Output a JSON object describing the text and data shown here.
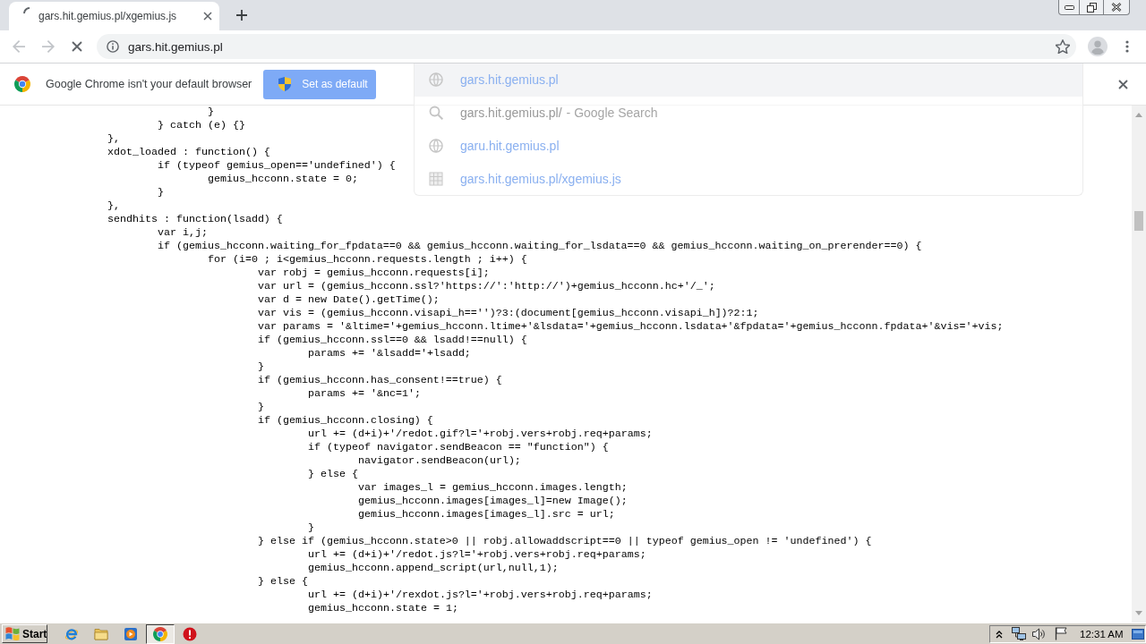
{
  "tab_strip": {
    "tabs": [
      {
        "title": "gars.hit.gemius.pl/xgemius.js",
        "selected": true,
        "loading": true
      }
    ]
  },
  "toolbar": {
    "nav": [
      {
        "kind": "back",
        "disabled": true
      },
      {
        "kind": "forward",
        "disabled": true
      },
      {
        "kind": "stop",
        "disabled": false
      }
    ],
    "omnibox": {
      "value": "gars.hit.gemius.pl"
    }
  },
  "infobar": {
    "message": "Google Chrome isn't your default browser",
    "button": "Set as default"
  },
  "suggestions": [
    {
      "kind": "url",
      "text": "gars.hit.gemius.pl",
      "selected": true
    },
    {
      "kind": "search",
      "text": "gars.hit.gemius.pl/",
      "description": "- Google Search",
      "selected": false
    },
    {
      "kind": "url",
      "text": "garu.hit.gemius.pl",
      "selected": false
    },
    {
      "kind": "page",
      "text": "gars.hit.gemius.pl/xgemius.js",
      "selected": false
    }
  ],
  "code": {
    "lines": [
      {
        "children": [
          {
            "children": [
              {
                "text": "}"
              }
            ]
          },
          {
            "text": "} catch (e) {}"
          }
        ]
      },
      {
        "text": "},"
      },
      {
        "text": "xdot_loaded : function() {",
        "children": [
          {
            "text": "if (typeof gemius_open=='undefined') {",
            "children": [
              {
                "text": "gemius_hcconn.state = 0;"
              }
            ]
          },
          {
            "text": "}"
          }
        ]
      },
      {
        "text": "},"
      },
      {
        "text": "sendhits : function(lsadd) {",
        "children": [
          {
            "text": "var i,j;"
          },
          {
            "text": "if (gemius_hcconn.waiting_for_fpdata==0 && gemius_hcconn.waiting_for_lsdata==0 && gemius_hcconn.waiting_on_prerender==0) {",
            "children": [
              {
                "text": "for (i=0 ; i<gemius_hcconn.requests.length ; i++) {",
                "children": [
                  {
                    "text": "var robj = gemius_hcconn.requests[i];"
                  },
                  {
                    "text": "var url = (gemius_hcconn.ssl?'https://':'http://')+gemius_hcconn.hc+'/_';"
                  },
                  {
                    "text": "var d = new Date().getTime();"
                  },
                  {
                    "text": "var vis = (gemius_hcconn.visapi_h=='')?3:(document[gemius_hcconn.visapi_h])?2:1;"
                  },
                  {
                    "text": "var params = '&ltime='+gemius_hcconn.ltime+'&lsdata='+gemius_hcconn.lsdata+'&fpdata='+gemius_hcconn.fpdata+'&vis='+vis;"
                  },
                  {
                    "text": "if (gemius_hcconn.ssl==0 && lsadd!==null) {",
                    "children": [
                      {
                        "text": "params += '&lsadd='+lsadd;"
                      }
                    ]
                  },
                  {
                    "text": "}"
                  },
                  {
                    "text": "if (gemius_hcconn.has_consent!==true) {",
                    "children": [
                      {
                        "text": "params += '&nc=1';"
                      }
                    ]
                  },
                  {
                    "text": "}"
                  },
                  {
                    "text": "if (gemius_hcconn.closing) {",
                    "children": [
                      {
                        "text": "url += (d+i)+'/redot.gif?l='+robj.vers+robj.req+params;"
                      },
                      {
                        "text": "if (typeof navigator.sendBeacon == \"function\") {",
                        "children": [
                          {
                            "text": "navigator.sendBeacon(url);"
                          }
                        ]
                      },
                      {
                        "text": "} else {",
                        "children": [
                          {
                            "text": "var images_l = gemius_hcconn.images.length;"
                          },
                          {
                            "text": "gemius_hcconn.images[images_l]=new Image();"
                          },
                          {
                            "text": "gemius_hcconn.images[images_l].src = url;"
                          }
                        ]
                      },
                      {
                        "text": "}"
                      }
                    ]
                  },
                  {
                    "text": "} else if (gemius_hcconn.state>0 || robj.allowaddscript==0 || typeof gemius_open != 'undefined') {",
                    "children": [
                      {
                        "text": "url += (d+i)+'/redot.js?l='+robj.vers+robj.req+params;"
                      },
                      {
                        "text": "gemius_hcconn.append_script(url,null,1);"
                      }
                    ]
                  },
                  {
                    "text": "} else {",
                    "children": [
                      {
                        "text": "url += (d+i)+'/rexdot.js?l='+robj.vers+robj.req+params;"
                      },
                      {
                        "text": "gemius_hcconn.state = 1;"
                      }
                    ]
                  }
                ]
              }
            ]
          }
        ]
      }
    ]
  },
  "taskbar": {
    "start": "Start",
    "apps": [
      {
        "kind": "ie",
        "selected": false
      },
      {
        "kind": "folder",
        "selected": false
      },
      {
        "kind": "media",
        "selected": false
      },
      {
        "kind": "chrome",
        "selected": true
      },
      {
        "kind": "alert",
        "selected": false
      }
    ],
    "tray": {
      "clock": "12:31 AM"
    }
  }
}
